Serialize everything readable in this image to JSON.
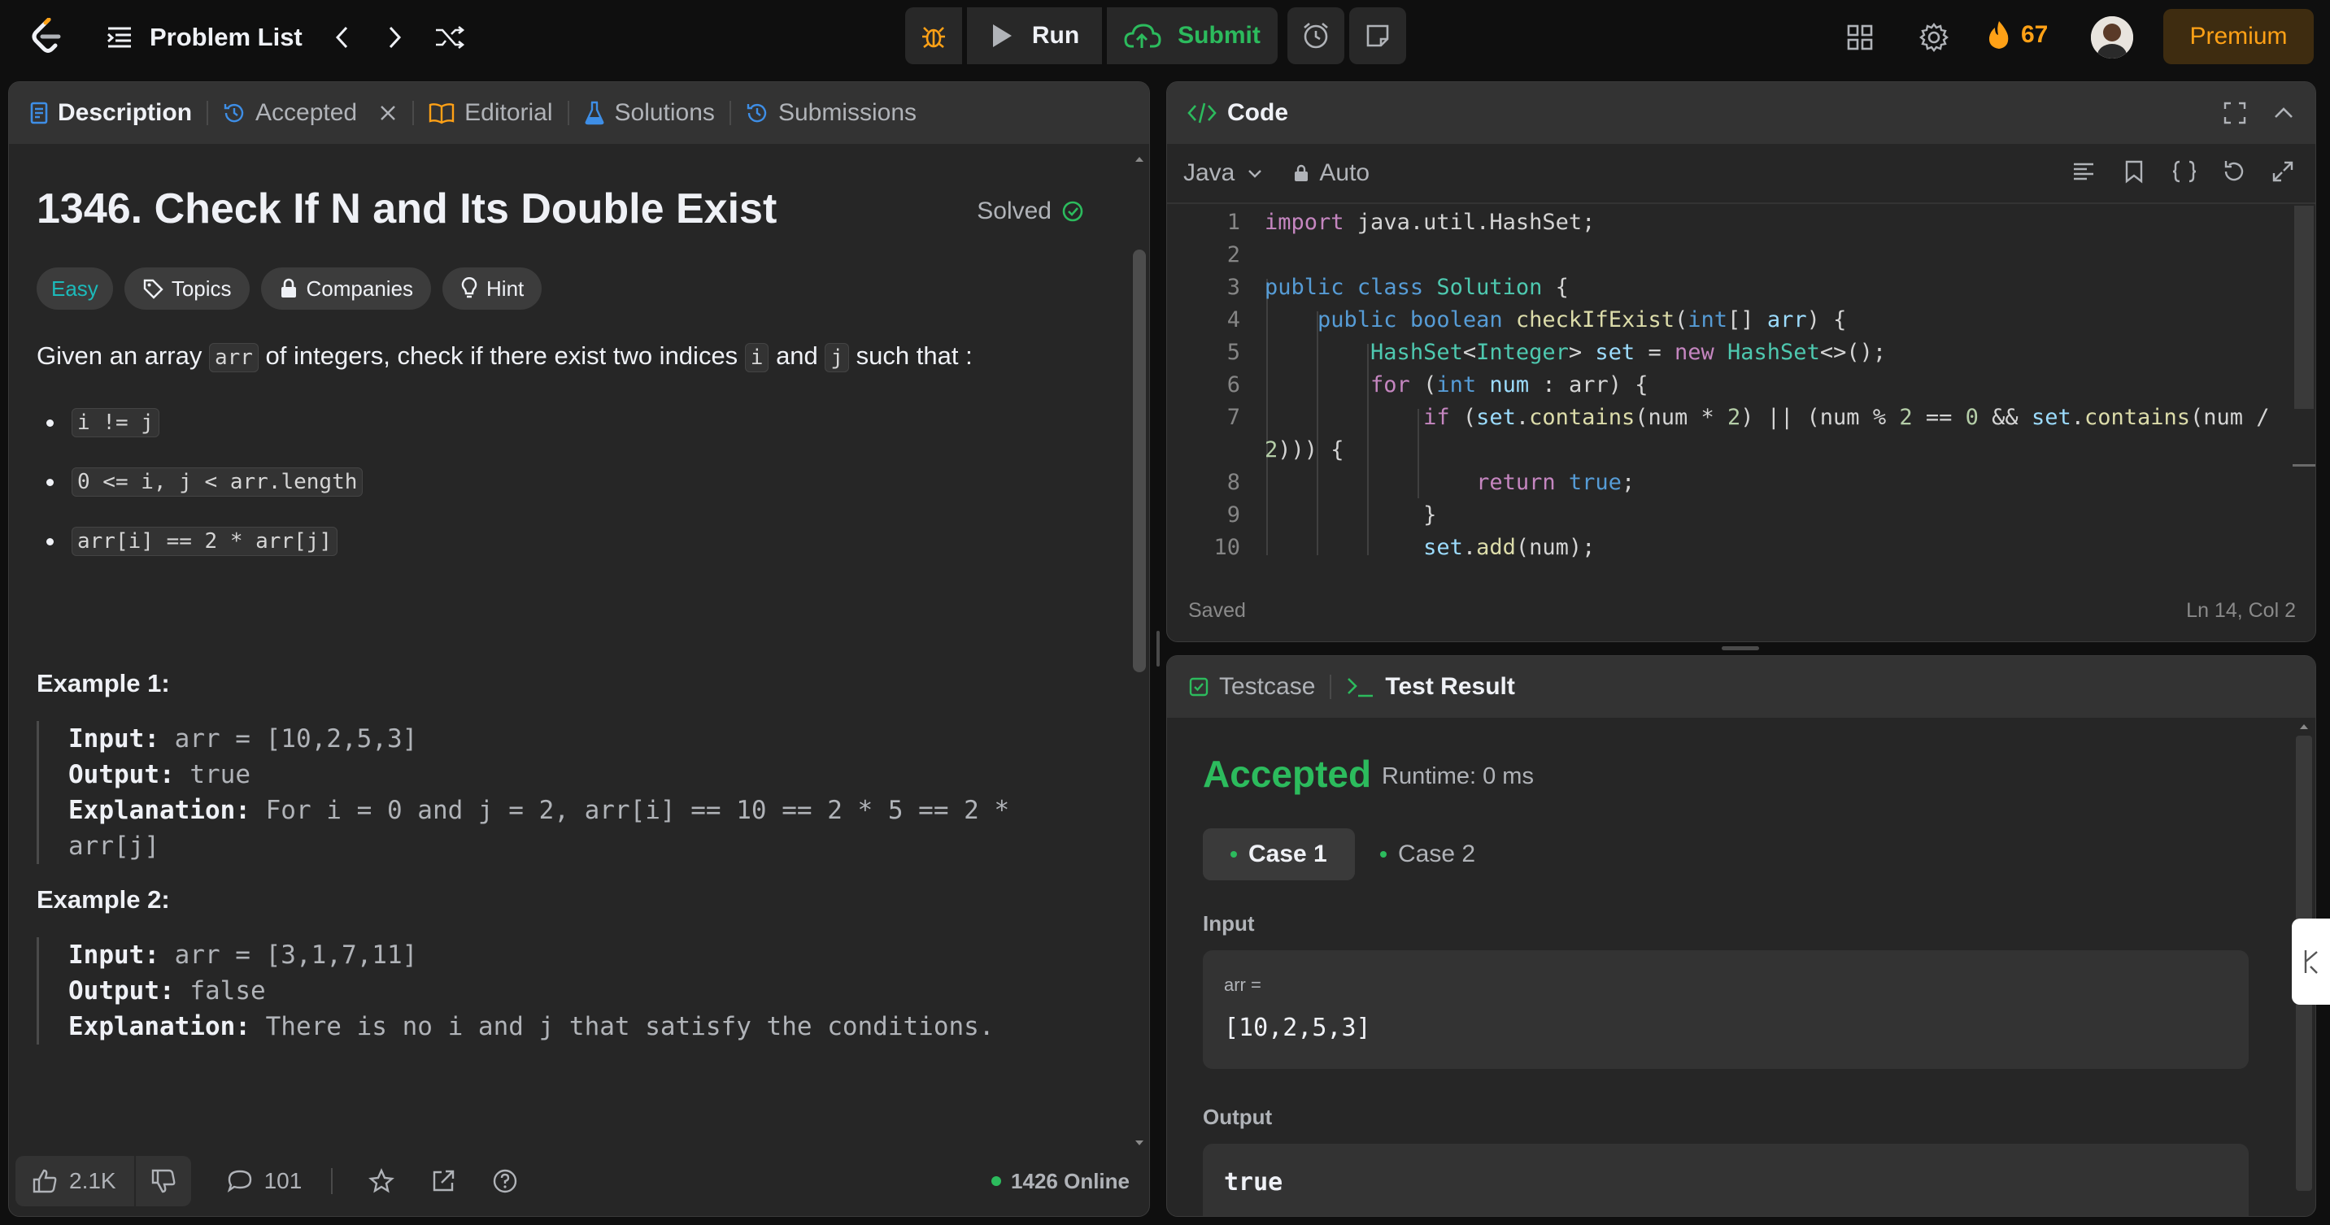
{
  "nav": {
    "title": "Problem List",
    "run_label": "Run",
    "submit_label": "Submit",
    "streak": "67",
    "premium_label": "Premium"
  },
  "left_tabs": [
    {
      "label": "Description"
    },
    {
      "label": "Accepted"
    },
    {
      "label": "Editorial"
    },
    {
      "label": "Solutions"
    },
    {
      "label": "Submissions"
    }
  ],
  "problem": {
    "title": "1346. Check If N and Its Double Exist",
    "status": "Solved",
    "chips": {
      "difficulty": "Easy",
      "topics": "Topics",
      "companies": "Companies",
      "hint": "Hint"
    },
    "statement": {
      "p1": "Given an array ",
      "c1": "arr",
      "p2": " of integers, check if there exist two indices ",
      "c2": "i",
      "p3": " and ",
      "c3": "j",
      "p4": " such that :"
    },
    "conditions": [
      "i != j",
      "0 <= i, j < arr.length",
      "arr[i] == 2 * arr[j]"
    ],
    "examples": [
      {
        "title": "Example 1:",
        "input_label": "Input:",
        "input": "arr = [10,2,5,3]",
        "output_label": "Output:",
        "output": "true",
        "explanation_label": "Explanation:",
        "explanation_1": "For i = 0 and j = 2, arr[i] == 10 == 2 * 5 == 2 *",
        "explanation_2": "arr[j]"
      },
      {
        "title": "Example 2:",
        "input_label": "Input:",
        "input": "arr = [3,1,7,11]",
        "output_label": "Output:",
        "output": "false",
        "explanation_label": "Explanation:",
        "explanation_1": "There is no i and j that satisfy the conditions."
      }
    ]
  },
  "footer": {
    "likes": "2.1K",
    "comments": "101",
    "online": "1426 Online"
  },
  "code": {
    "header": "Code",
    "language": "Java",
    "mode": "Auto",
    "status_left": "Saved",
    "status_right": "Ln 14, Col 2",
    "line_numbers": [
      "1",
      "2",
      "3",
      "4",
      "5",
      "6",
      "7",
      "8",
      "9",
      "10"
    ]
  },
  "test": {
    "tab_testcase": "Testcase",
    "tab_result": "Test Result",
    "verdict": "Accepted",
    "runtime": "Runtime: 0 ms",
    "cases": [
      "Case 1",
      "Case 2"
    ],
    "input_label": "Input",
    "input_var": "arr =",
    "input_value": "[10,2,5,3]",
    "output_label": "Output",
    "output_value": "true"
  },
  "colors": {
    "accent": "#ffa116",
    "green": "#2cbb5d",
    "easy": "#1cbaba"
  }
}
